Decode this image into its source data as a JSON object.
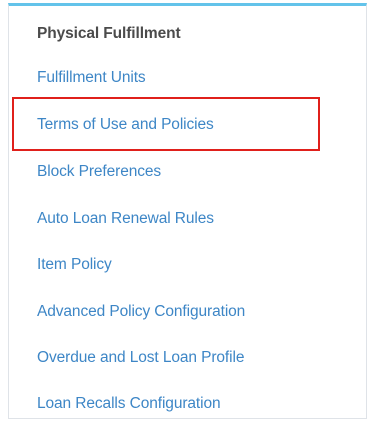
{
  "panel": {
    "heading": "Physical Fulfillment",
    "accent_color": "#63c3ea",
    "link_color": "#3d86c6",
    "items": [
      {
        "label": "Fulfillment Units"
      },
      {
        "label": "Terms of Use and Policies",
        "highlighted": true
      },
      {
        "label": "Block Preferences"
      },
      {
        "label": "Auto Loan Renewal Rules"
      },
      {
        "label": "Item Policy"
      },
      {
        "label": "Advanced Policy Configuration"
      },
      {
        "label": "Overdue and Lost Loan Profile"
      },
      {
        "label": "Loan Recalls Configuration"
      }
    ]
  },
  "highlight": {
    "target": "Terms of Use and Policies",
    "color": "#e0201b"
  }
}
